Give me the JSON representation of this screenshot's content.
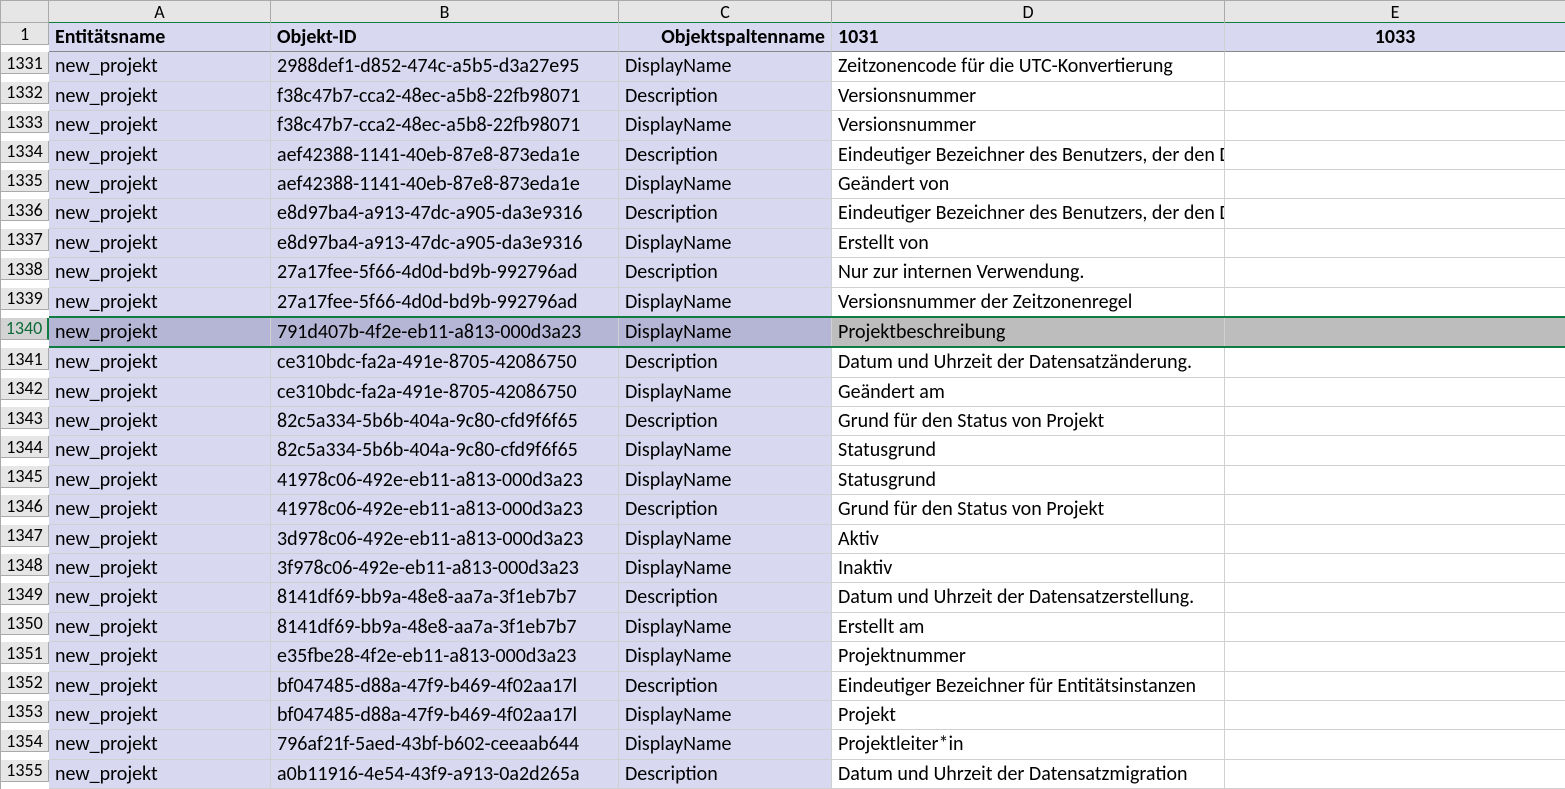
{
  "columns": [
    "A",
    "B",
    "C",
    "D",
    "E"
  ],
  "headerRow": "1",
  "headers": {
    "A": "Entitätsname",
    "B": "Objekt-ID",
    "C": "Objektspaltenname",
    "D": "1031",
    "E": "1033"
  },
  "selectedRow": "1340",
  "rows": [
    {
      "n": "1331",
      "A": "new_projekt",
      "B": "2988def1-d852-474c-a5b5-d3a27e95",
      "C": "DisplayName",
      "D": "Zeitzonencode für die UTC-Konvertierung",
      "E": ""
    },
    {
      "n": "1332",
      "A": "new_projekt",
      "B": "f38c47b7-cca2-48ec-a5b8-22fb98071",
      "C": "Description",
      "D": "Versionsnummer",
      "E": ""
    },
    {
      "n": "1333",
      "A": "new_projekt",
      "B": "f38c47b7-cca2-48ec-a5b8-22fb98071",
      "C": "DisplayName",
      "D": "Versionsnummer",
      "E": ""
    },
    {
      "n": "1334",
      "A": "new_projekt",
      "B": "aef42388-1141-40eb-87e8-873eda1e",
      "C": "Description",
      "D": "Eindeutiger Bezeichner des Benutzers, der den Datensatz geändert hat.",
      "E": ""
    },
    {
      "n": "1335",
      "A": "new_projekt",
      "B": "aef42388-1141-40eb-87e8-873eda1e",
      "C": "DisplayName",
      "D": "Geändert von",
      "E": ""
    },
    {
      "n": "1336",
      "A": "new_projekt",
      "B": "e8d97ba4-a913-47dc-a905-da3e9316",
      "C": "Description",
      "D": "Eindeutiger Bezeichner des Benutzers, der den Datensatz erstellt hat.",
      "E": ""
    },
    {
      "n": "1337",
      "A": "new_projekt",
      "B": "e8d97ba4-a913-47dc-a905-da3e9316",
      "C": "DisplayName",
      "D": "Erstellt von",
      "E": ""
    },
    {
      "n": "1338",
      "A": "new_projekt",
      "B": "27a17fee-5f66-4d0d-bd9b-992796ad",
      "C": "Description",
      "D": "Nur zur internen Verwendung.",
      "E": ""
    },
    {
      "n": "1339",
      "A": "new_projekt",
      "B": "27a17fee-5f66-4d0d-bd9b-992796ad",
      "C": "DisplayName",
      "D": "Versionsnummer der Zeitzonenregel",
      "E": ""
    },
    {
      "n": "1340",
      "A": "new_projekt",
      "B": "791d407b-4f2e-eb11-a813-000d3a23",
      "C": "DisplayName",
      "D": "Projektbeschreibung",
      "E": ""
    },
    {
      "n": "1341",
      "A": "new_projekt",
      "B": "ce310bdc-fa2a-491e-8705-42086750",
      "C": "Description",
      "D": "Datum und Uhrzeit der Datensatzänderung.",
      "E": ""
    },
    {
      "n": "1342",
      "A": "new_projekt",
      "B": "ce310bdc-fa2a-491e-8705-42086750",
      "C": "DisplayName",
      "D": "Geändert am",
      "E": ""
    },
    {
      "n": "1343",
      "A": "new_projekt",
      "B": "82c5a334-5b6b-404a-9c80-cfd9f6f65",
      "C": "Description",
      "D": "Grund für den Status von Projekt",
      "E": ""
    },
    {
      "n": "1344",
      "A": "new_projekt",
      "B": "82c5a334-5b6b-404a-9c80-cfd9f6f65",
      "C": "DisplayName",
      "D": "Statusgrund",
      "E": ""
    },
    {
      "n": "1345",
      "A": "new_projekt",
      "B": "41978c06-492e-eb11-a813-000d3a23",
      "C": "DisplayName",
      "D": "Statusgrund",
      "E": ""
    },
    {
      "n": "1346",
      "A": "new_projekt",
      "B": "41978c06-492e-eb11-a813-000d3a23",
      "C": "Description",
      "D": "Grund für den Status von Projekt",
      "E": ""
    },
    {
      "n": "1347",
      "A": "new_projekt",
      "B": "3d978c06-492e-eb11-a813-000d3a23",
      "C": "DisplayName",
      "D": "Aktiv",
      "E": ""
    },
    {
      "n": "1348",
      "A": "new_projekt",
      "B": "3f978c06-492e-eb11-a813-000d3a23",
      "C": "DisplayName",
      "D": "Inaktiv",
      "E": ""
    },
    {
      "n": "1349",
      "A": "new_projekt",
      "B": "8141df69-bb9a-48e8-aa7a-3f1eb7b7",
      "C": "Description",
      "D": "Datum und Uhrzeit der Datensatzerstellung.",
      "E": ""
    },
    {
      "n": "1350",
      "A": "new_projekt",
      "B": "8141df69-bb9a-48e8-aa7a-3f1eb7b7",
      "C": "DisplayName",
      "D": "Erstellt am",
      "E": ""
    },
    {
      "n": "1351",
      "A": "new_projekt",
      "B": "e35fbe28-4f2e-eb11-a813-000d3a23",
      "C": "DisplayName",
      "D": "Projektnummer",
      "E": ""
    },
    {
      "n": "1352",
      "A": "new_projekt",
      "B": "bf047485-d88a-47f9-b469-4f02aa17l",
      "C": "Description",
      "D": "Eindeutiger Bezeichner für Entitätsinstanzen",
      "E": ""
    },
    {
      "n": "1353",
      "A": "new_projekt",
      "B": "bf047485-d88a-47f9-b469-4f02aa17l",
      "C": "DisplayName",
      "D": "Projekt",
      "E": ""
    },
    {
      "n": "1354",
      "A": "new_projekt",
      "B": "796af21f-5aed-43bf-b602-ceeaab644",
      "C": "DisplayName",
      "D": "Projektleiter*in",
      "E": ""
    },
    {
      "n": "1355",
      "A": "new_projekt",
      "B": "a0b11916-4e54-43f9-a913-0a2d265a",
      "C": "Description",
      "D": "Datum und Uhrzeit der Datensatzmigration",
      "E": ""
    }
  ]
}
